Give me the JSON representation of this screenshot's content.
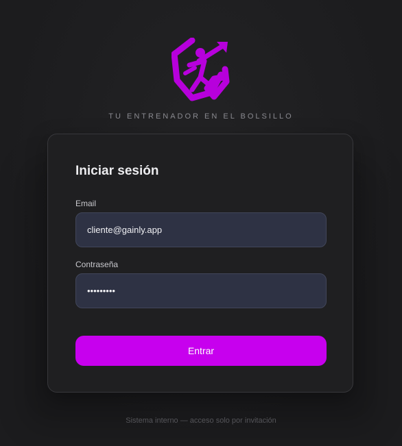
{
  "brand": {
    "tagline": "TU ENTRENADOR EN EL BOLSILLO",
    "logo_icon": "gainly-shield-runner-icon",
    "accent_color": "#c700ee"
  },
  "login": {
    "title": "Iniciar sesión",
    "email_label": "Email",
    "email_value": "cliente@gainly.app",
    "password_label": "Contraseña",
    "password_value": "123456789",
    "submit_label": "Entrar"
  },
  "footer": {
    "text": "Sistema interno — acceso solo por invitación"
  }
}
